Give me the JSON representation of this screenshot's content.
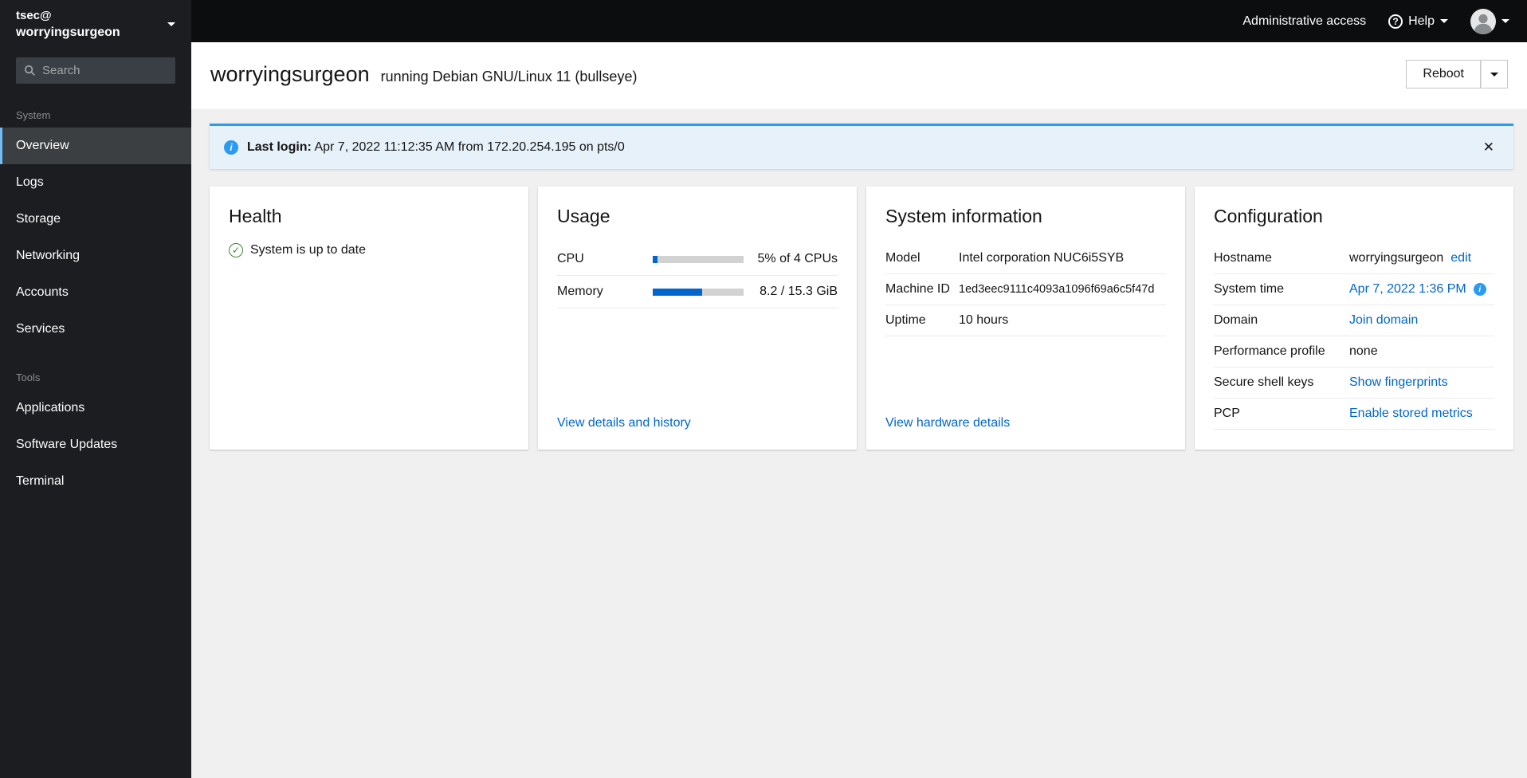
{
  "colors": {
    "accent": "#0066cc",
    "info": "#2b9af3",
    "success": "#3e8635",
    "selected_border": "#73bcf7"
  },
  "icons": {
    "help": "?",
    "info": "i",
    "success_check": "✓",
    "close": "✕"
  },
  "masthead": {
    "admin_access": "Administrative access",
    "help_label": "Help"
  },
  "sidebar": {
    "user": "tsec@",
    "host": "worryingsurgeon",
    "search_placeholder": "Search",
    "sections": [
      {
        "label": "System",
        "items": [
          {
            "label": "Overview"
          },
          {
            "label": "Logs"
          },
          {
            "label": "Storage"
          },
          {
            "label": "Networking"
          },
          {
            "label": "Accounts"
          },
          {
            "label": "Services"
          }
        ]
      },
      {
        "label": "Tools",
        "items": [
          {
            "label": "Applications"
          },
          {
            "label": "Software Updates"
          },
          {
            "label": "Terminal"
          }
        ]
      }
    ]
  },
  "header": {
    "hostname": "worryingsurgeon",
    "os": "running Debian GNU/Linux 11 (bullseye)",
    "reboot_label": "Reboot"
  },
  "alert": {
    "title": "Last login:",
    "message": "Apr 7, 2022 11:12:35 AM from 172.20.254.195 on pts/0"
  },
  "cards": {
    "health": {
      "title": "Health",
      "status": "System is up to date"
    },
    "usage": {
      "title": "Usage",
      "cpu_label": "CPU",
      "cpu_value": "5% of 4 CPUs",
      "cpu_percent": 5,
      "memory_label": "Memory",
      "memory_value": "8.2 / 15.3 GiB",
      "memory_percent": 54,
      "link": "View details and history"
    },
    "system_info": {
      "title": "System information",
      "model_label": "Model",
      "model_value": "Intel corporation NUC6i5SYB",
      "machine_id_label": "Machine ID",
      "machine_id_value": "1ed3eec9111c4093a1096f69a6c5f47d",
      "uptime_label": "Uptime",
      "uptime_value": "10 hours",
      "link": "View hardware details"
    },
    "configuration": {
      "title": "Configuration",
      "hostname_label": "Hostname",
      "hostname_value": "worryingsurgeon",
      "hostname_edit": "edit",
      "systime_label": "System time",
      "systime_value": "Apr 7, 2022 1:36 PM",
      "domain_label": "Domain",
      "domain_link": "Join domain",
      "perf_label": "Performance profile",
      "perf_value": "none",
      "ssh_label": "Secure shell keys",
      "ssh_link": "Show fingerprints",
      "pcp_label": "PCP",
      "pcp_link": "Enable stored metrics"
    }
  }
}
